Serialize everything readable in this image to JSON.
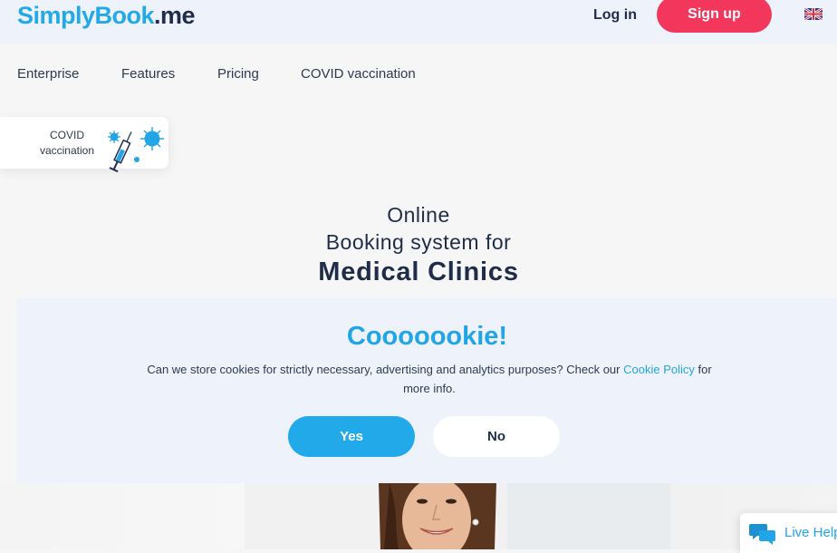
{
  "header": {
    "logo_part1": "Simply",
    "logo_part2": "Book",
    "logo_part3": ".me",
    "login_label": "Log in",
    "signup_label": "Sign up",
    "language_icon": "uk-flag-icon"
  },
  "nav": {
    "items": [
      {
        "label": "Enterprise"
      },
      {
        "label": "Features"
      },
      {
        "label": "Pricing"
      },
      {
        "label": "COVID vaccination"
      }
    ]
  },
  "covid_card": {
    "line1": "COVID",
    "line2": "vaccination",
    "icon": "syringe-virus-icon"
  },
  "hero": {
    "line1": "Online",
    "line2": "Booking system for",
    "line3": "Medical Clinics"
  },
  "cookie_banner": {
    "title": "Cooooookie!",
    "text_before": "Can we store cookies for strictly necessary, advertising and analytics purposes? Check our ",
    "link_text": "Cookie Policy",
    "text_after": " for more info.",
    "yes_label": "Yes",
    "no_label": "No"
  },
  "live_help": {
    "label": "Live Help",
    "icon": "chat-bubbles-icon"
  },
  "colors": {
    "brand_blue": "#21a5e6",
    "brand_navy": "#1f2d4a",
    "signup_red": "#f2365c",
    "banner_bg": "#eef3fb"
  }
}
